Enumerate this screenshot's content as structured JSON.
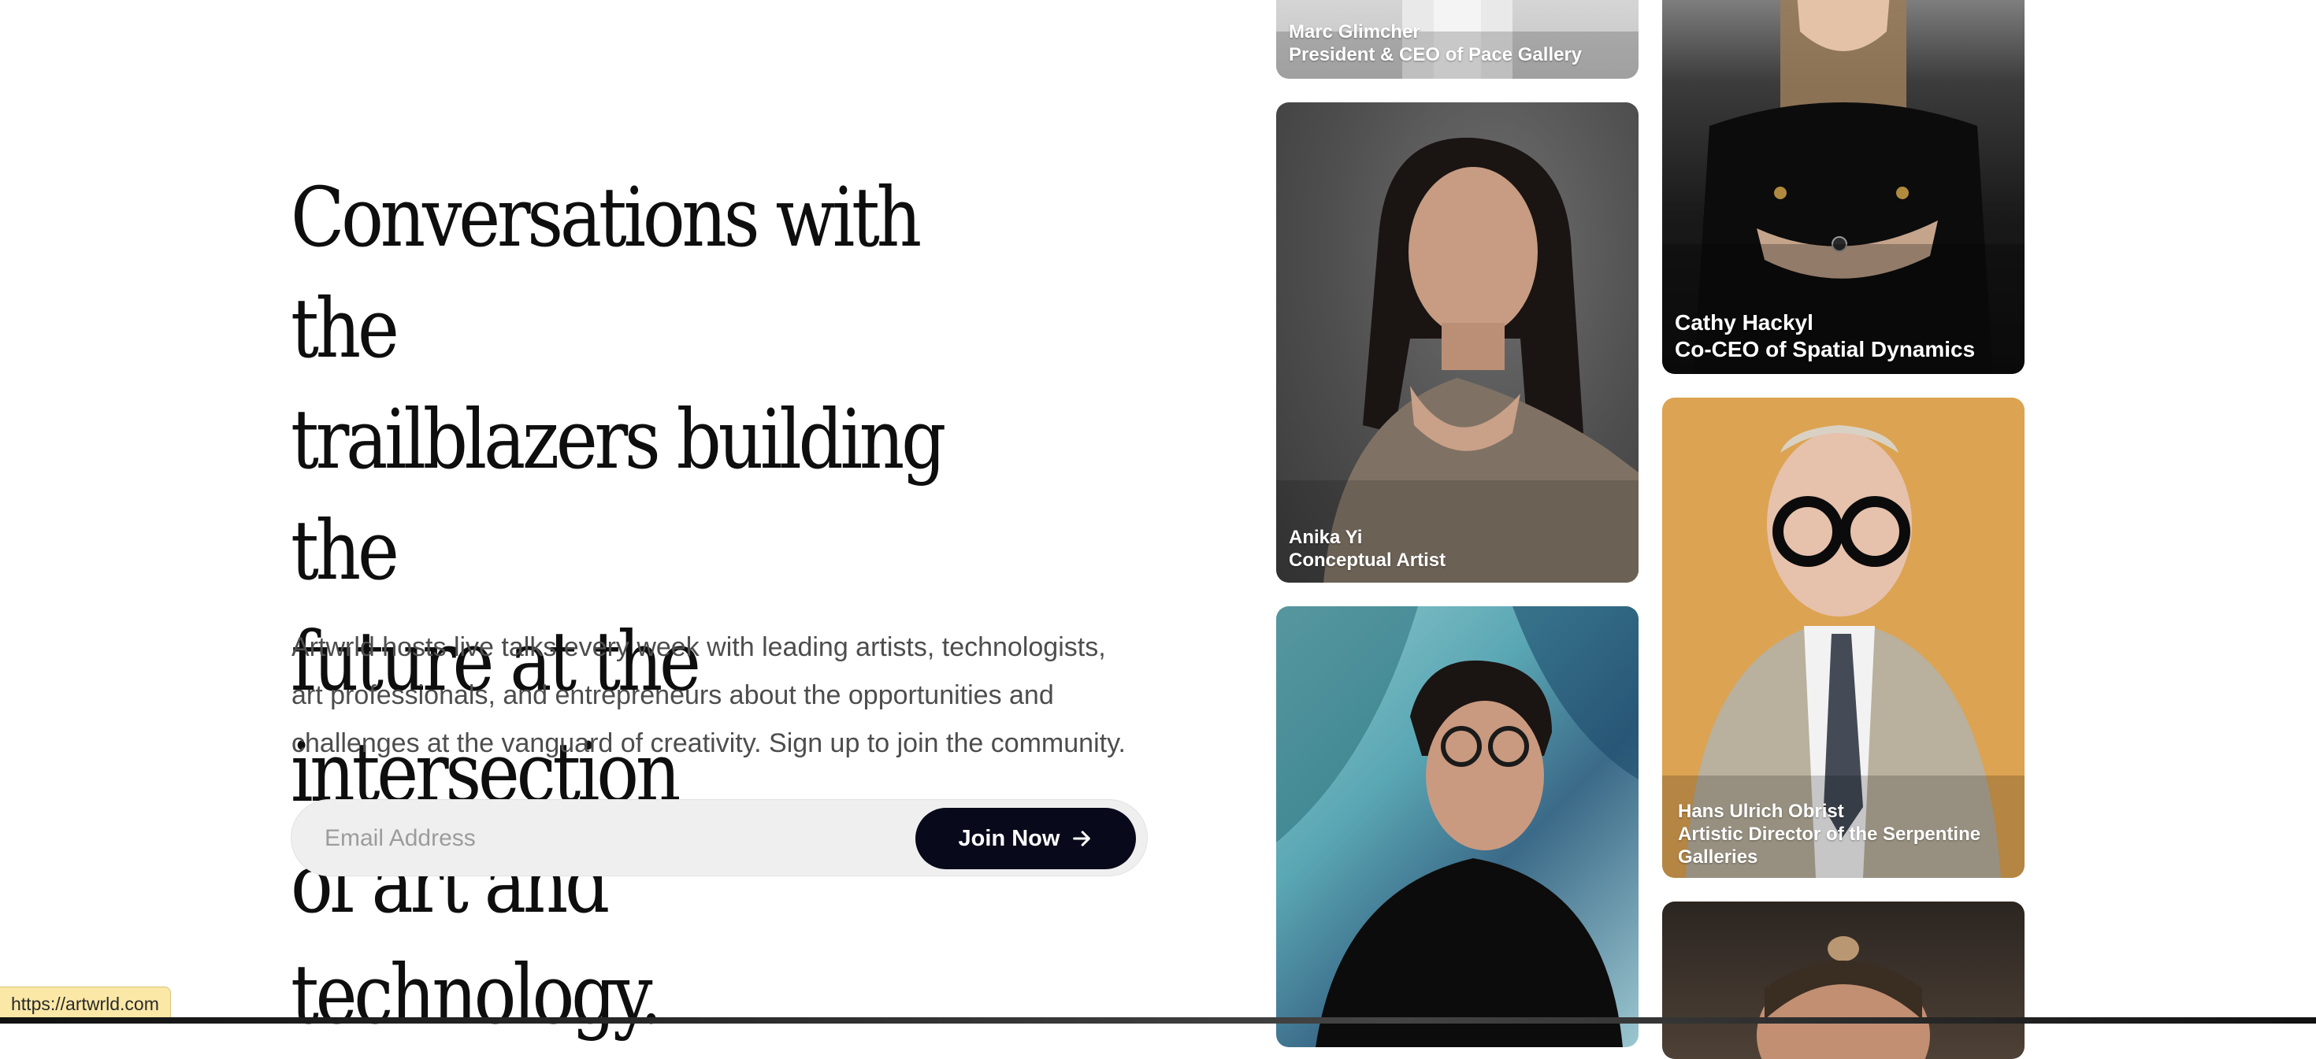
{
  "hero": {
    "title_lines": [
      "Conversations with the",
      "trailblazers building the",
      "future at the intersection",
      "of art and technology."
    ],
    "subtitle_lines": [
      "Artwrld hosts live talks every week with leading artists, technologists,",
      "art professionals, and entrepreneurs about the opportunities and",
      "challenges at the vanguard of creativity. Sign up to join the community."
    ]
  },
  "signup": {
    "email_placeholder": "Email Address",
    "email_value": "",
    "button_label": "Join Now",
    "button_icon": "arrow-right-icon"
  },
  "speakers": [
    {
      "name": "Marc Glimcher",
      "title": "President & CEO of Pace Gallery"
    },
    {
      "name": "Cathy Hackyl",
      "title": "Co-CEO of Spatial Dynamics"
    },
    {
      "name": "Anika Yi",
      "title": "Conceptual Artist"
    },
    {
      "name": "Hans Ulrich Obrist",
      "title": "Artistic Director of the Serpentine Galleries"
    }
  ],
  "status_bar": {
    "url": "https://artwrld.com"
  },
  "colors": {
    "button_bg": "#08091a",
    "input_bg": "#efefef",
    "heading": "#0e0e0e",
    "body_text": "#4d4d4d",
    "status_bg": "#fbe8a6"
  }
}
